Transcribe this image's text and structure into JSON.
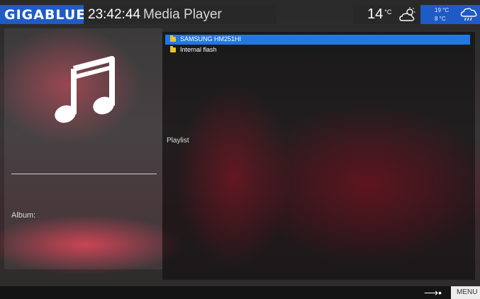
{
  "header": {
    "brand": "GIGABLUE",
    "time": "23:42:44",
    "title": "Media Player"
  },
  "weather": {
    "current_temp": "14",
    "current_unit": "°C",
    "current_icon": "cloud-sun-icon",
    "forecast_high": "19 °C",
    "forecast_low": "8 °C",
    "forecast_icon": "cloud-rain-icon"
  },
  "left_panel": {
    "icon": "music-note-icon",
    "album_label": "Album:"
  },
  "file_list": {
    "items": [
      {
        "label": "SAMSUNG HM251HI",
        "selected": true
      },
      {
        "label": "Internal flash",
        "selected": false
      }
    ],
    "playlist_label": "Playlist"
  },
  "footer": {
    "menu_label": "MENU"
  },
  "colors": {
    "accent_blue": "#1e5bc6",
    "selection_blue": "#1e78e6",
    "folder_yellow": "#f0c22a"
  }
}
